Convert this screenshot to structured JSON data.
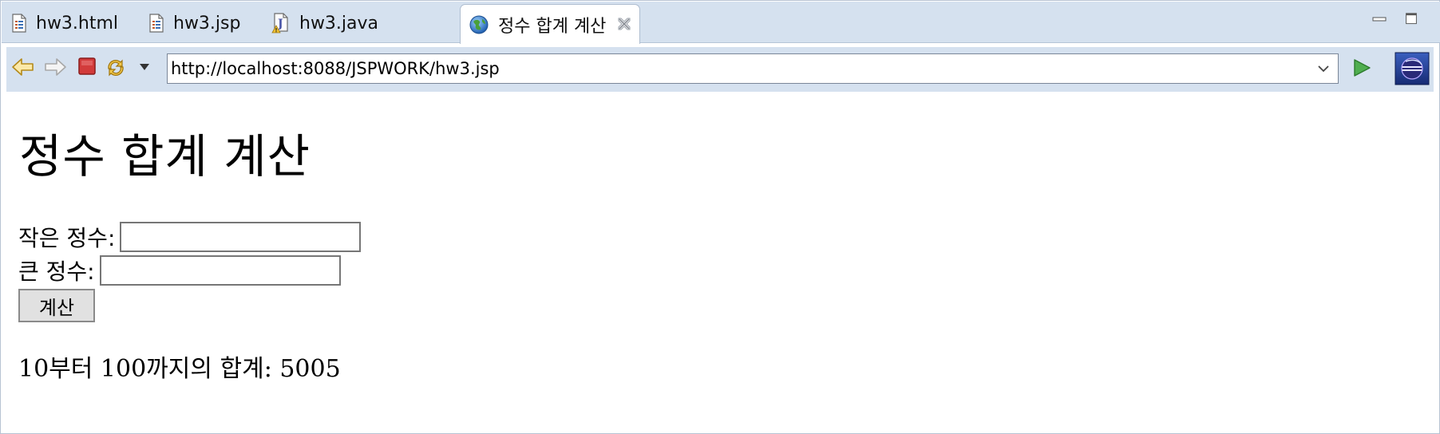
{
  "tabs": [
    {
      "label": "hw3.html",
      "icon": "html-file-icon"
    },
    {
      "label": "hw3.jsp",
      "icon": "jsp-file-icon"
    },
    {
      "label": "hw3.java",
      "icon": "java-file-icon"
    },
    {
      "label": "정수 합계 계산",
      "icon": "globe-icon",
      "active": true
    }
  ],
  "toolbar": {
    "url": "http://localhost:8088/JSPWORK/hw3.jsp"
  },
  "page": {
    "title": "정수 합계 계산",
    "small_label": "작은 정수:",
    "small_value": "",
    "large_label": "큰 정수:",
    "large_value": "",
    "calc_button": "계산",
    "result": "10부터 100까지의 합계: 5005"
  },
  "colors": {
    "chrome_bg": "#d5e1ef",
    "go_arrow": "#3a9a3a",
    "stop_red": "#d23b3b"
  }
}
